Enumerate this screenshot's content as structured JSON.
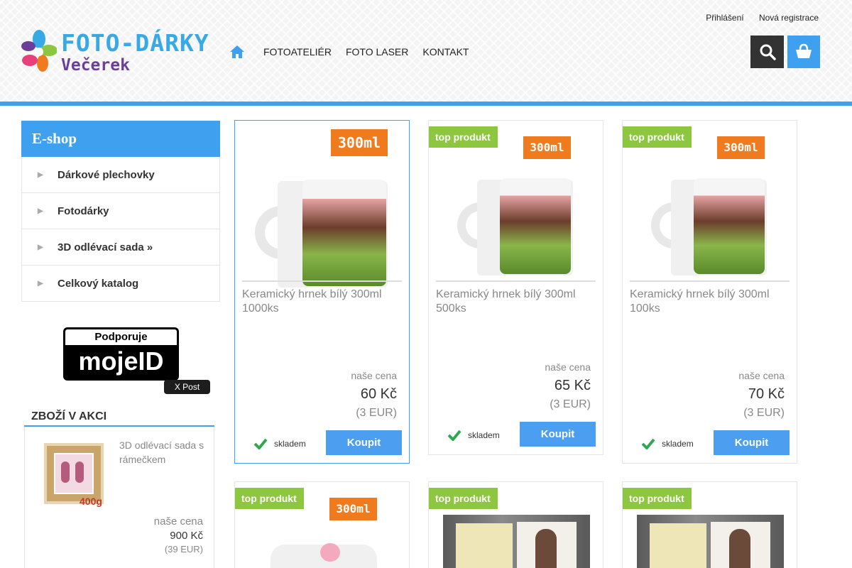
{
  "header": {
    "logo_line1": "FOTO-DÁRKY",
    "logo_line2": "Večerek",
    "login": "Přihlášení",
    "register": "Nová registrace",
    "nav": [
      "FOTOATELIÉR",
      "FOTO LASER",
      "KONTAKT"
    ]
  },
  "sidebar": {
    "title": "E-shop",
    "categories": [
      "Dárkové plechovky",
      "Fotodárky",
      "3D odlévací sada »",
      "Celkový katalog"
    ],
    "mojeid_top": "Podporuje",
    "mojeid_bottom": "mojeID",
    "xpost": "X Post"
  },
  "akce": {
    "title": "ZBOŽÍ V AKCI",
    "name": "3D odlévací sada s rámečkem",
    "weight": "400g",
    "label": "naše cena",
    "price": "900 Kč",
    "eur": "(39 EUR)"
  },
  "products": [
    {
      "name": "Keramický hrnek bílý 300ml 1000ks",
      "label": "naše cena",
      "price": "60 Kč",
      "eur": "(3 EUR)",
      "stock": "skladem",
      "buy": "Koupit",
      "badge": "",
      "volume": "300ml"
    },
    {
      "name": "Keramický hrnek bílý 300ml 500ks",
      "label": "naše cena",
      "price": "65 Kč",
      "eur": "(3 EUR)",
      "stock": "skladem",
      "buy": "Koupit",
      "badge": "top produkt",
      "volume": "300ml"
    },
    {
      "name": "Keramický hrnek bílý 300ml 100ks",
      "label": "naše cena",
      "price": "70 Kč",
      "eur": "(3 EUR)",
      "stock": "skladem",
      "buy": "Koupit",
      "badge": "top produkt",
      "volume": "300ml"
    },
    {
      "badge": "top produkt",
      "volume": "300ml"
    },
    {
      "badge": "top produkt"
    },
    {
      "badge": "top produkt"
    }
  ],
  "colors": {
    "accent": "#3ea0ee",
    "badge": "#8dc63f",
    "volume": "#f07b1f",
    "buy": "#4b9ef0"
  },
  "icons": [
    "home-icon",
    "search-icon",
    "cart-icon",
    "check-icon",
    "arrow-right-icon"
  ]
}
